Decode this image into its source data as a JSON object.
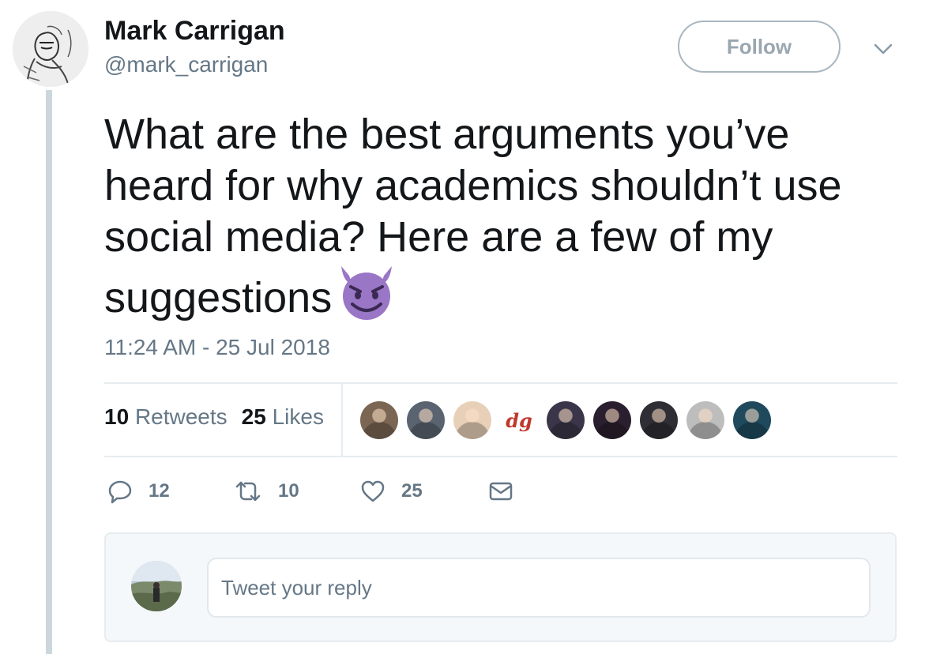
{
  "author": {
    "name": "Mark Carrigan",
    "handle": "@mark_carrigan"
  },
  "follow_button": {
    "label": "Follow"
  },
  "tweet": {
    "text": "What are the best arguments you’ve heard for why academics shouldn’t use social media? Here are a few of my suggestions",
    "emoji": "smiling-face-with-horns",
    "timestamp": "11:24 AM - 25 Jul 2018"
  },
  "stats": {
    "retweets_count": "10",
    "retweets_label": "Retweets",
    "likes_count": "25",
    "likes_label": "Likes"
  },
  "liker_avatars": [
    {
      "color": "#7a6652"
    },
    {
      "color": "#5a6470"
    },
    {
      "color": "#e8d0b8"
    },
    {
      "color": "#ffffff",
      "text": "dg"
    },
    {
      "color": "#3a3548"
    },
    {
      "color": "#2a1f2e"
    },
    {
      "color": "#2e2e34"
    },
    {
      "color": "#bdbdbd"
    },
    {
      "color": "#1f4a5e"
    }
  ],
  "actions": {
    "replies": "12",
    "retweets": "10",
    "likes": "25"
  },
  "reply": {
    "placeholder": "Tweet your reply"
  },
  "colors": {
    "text": "#14171a",
    "secondary": "#657786",
    "border": "#e6ecf0",
    "devil": "#9a76c6"
  }
}
